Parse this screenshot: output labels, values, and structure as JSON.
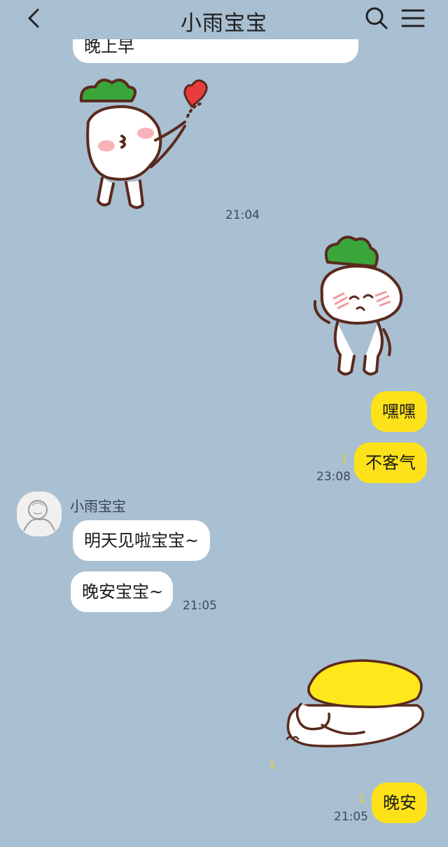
{
  "header": {
    "title": "小雨宝宝",
    "back_icon": "chevron-left-icon",
    "search_icon": "search-icon",
    "menu_icon": "hamburger-menu-icon"
  },
  "messages": {
    "partial_top_bubble": "晚上早",
    "sticker1_time": "21:04",
    "sticker2": "radish-sticker-shy",
    "my_msg1": "嘿嘿",
    "my_msg2": "不客气",
    "my_msg2_unread": "1",
    "my_msg2_time": "23:08",
    "sender_name": "小雨宝宝",
    "their_msg1": "明天见啦宝宝~",
    "their_msg2": "晚安宝宝~",
    "their_msg2_time": "21:05",
    "sticker3_unread": "1",
    "my_msg3": "晚安",
    "my_msg3_unread": "1",
    "my_msg3_time": "21:05"
  },
  "colors": {
    "background": "#a9bfd2",
    "my_bubble": "#fde21a",
    "their_bubble": "#ffffff",
    "unread_count": "#f2d21a"
  }
}
